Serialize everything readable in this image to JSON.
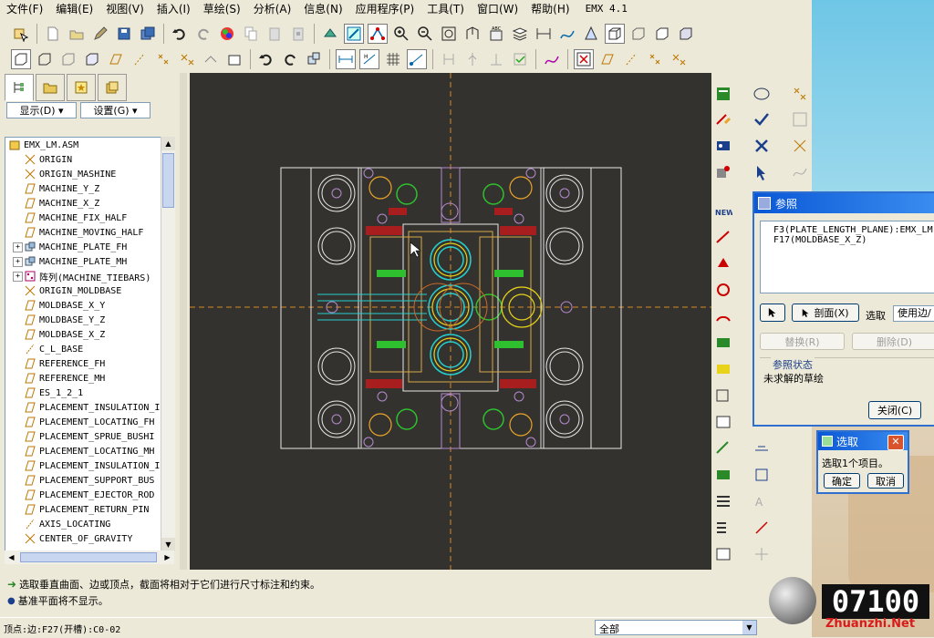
{
  "menu": [
    "文件(F)",
    "编辑(E)",
    "视图(V)",
    "插入(I)",
    "草绘(S)",
    "分析(A)",
    "信息(N)",
    "应用程序(P)",
    "工具(T)",
    "窗口(W)",
    "帮助(H)"
  ],
  "menu_version": "EMX 4.1",
  "left_panel": {
    "show_label": "显示(D) ▾",
    "settings_label": "设置(G) ▾",
    "tree": [
      {
        "label": "EMX_LM.ASM",
        "type": "asm",
        "indent": 0,
        "expander": ""
      },
      {
        "label": "ORIGIN",
        "type": "csys",
        "indent": 1,
        "expander": ""
      },
      {
        "label": "ORIGIN_MASHINE",
        "type": "csys",
        "indent": 1,
        "expander": ""
      },
      {
        "label": "MACHINE_Y_Z",
        "type": "plane",
        "indent": 1,
        "expander": ""
      },
      {
        "label": "MACHINE_X_Z",
        "type": "plane",
        "indent": 1,
        "expander": ""
      },
      {
        "label": "MACHINE_FIX_HALF",
        "type": "plane",
        "indent": 1,
        "expander": ""
      },
      {
        "label": "MACHINE_MOVING_HALF",
        "type": "plane",
        "indent": 1,
        "expander": ""
      },
      {
        "label": "MACHINE_PLATE_FH",
        "type": "part",
        "indent": 1,
        "expander": "+"
      },
      {
        "label": "MACHINE_PLATE_MH",
        "type": "part",
        "indent": 1,
        "expander": "+"
      },
      {
        "label": "阵列(MACHINE_TIEBARS)",
        "type": "pattern",
        "indent": 1,
        "expander": "+"
      },
      {
        "label": "ORIGIN_MOLDBASE",
        "type": "csys",
        "indent": 1,
        "expander": ""
      },
      {
        "label": "MOLDBASE_X_Y",
        "type": "plane",
        "indent": 1,
        "expander": ""
      },
      {
        "label": "MOLDBASE_Y_Z",
        "type": "plane",
        "indent": 1,
        "expander": ""
      },
      {
        "label": "MOLDBASE_X_Z",
        "type": "plane",
        "indent": 1,
        "expander": ""
      },
      {
        "label": "C_L_BASE",
        "type": "axis",
        "indent": 1,
        "expander": ""
      },
      {
        "label": "REFERENCE_FH",
        "type": "plane",
        "indent": 1,
        "expander": ""
      },
      {
        "label": "REFERENCE_MH",
        "type": "plane",
        "indent": 1,
        "expander": ""
      },
      {
        "label": "ES_1_2_1",
        "type": "plane",
        "indent": 1,
        "expander": ""
      },
      {
        "label": "PLACEMENT_INSULATION_I",
        "type": "plane",
        "indent": 1,
        "expander": ""
      },
      {
        "label": "PLACEMENT_LOCATING_FH",
        "type": "plane",
        "indent": 1,
        "expander": ""
      },
      {
        "label": "PLACEMENT_SPRUE_BUSHI",
        "type": "plane",
        "indent": 1,
        "expander": ""
      },
      {
        "label": "PLACEMENT_LOCATING_MH",
        "type": "plane",
        "indent": 1,
        "expander": ""
      },
      {
        "label": "PLACEMENT_INSULATION_I",
        "type": "plane",
        "indent": 1,
        "expander": ""
      },
      {
        "label": "PLACEMENT_SUPPORT_BUS",
        "type": "plane",
        "indent": 1,
        "expander": ""
      },
      {
        "label": "PLACEMENT_EJECTOR_ROD",
        "type": "plane",
        "indent": 1,
        "expander": ""
      },
      {
        "label": "PLACEMENT_RETURN_PIN",
        "type": "plane",
        "indent": 1,
        "expander": ""
      },
      {
        "label": "AXIS_LOCATING",
        "type": "axis",
        "indent": 1,
        "expander": ""
      },
      {
        "label": "CENTER_OF_GRAVITY",
        "type": "csys",
        "indent": 1,
        "expander": ""
      }
    ]
  },
  "ref_dialog": {
    "title": "参照",
    "refs": [
      "F3(PLATE_LENGTH_PLANE):EMX_LM",
      "F17(MOLDBASE_X_Z)"
    ],
    "section_btn": "剖面(X)",
    "select_label": "选取",
    "select_value": "使用边/",
    "replace_btn": "替换(R)",
    "delete_btn": "删除(D)",
    "status_heading": "参照状态",
    "status_text": "未求解的草绘",
    "close_btn": "关闭(C)"
  },
  "select_dialog": {
    "title": "选取",
    "message": "选取1个项目。",
    "ok_btn": "确定",
    "cancel_btn": "取消"
  },
  "messages": [
    "选取垂直曲面、边或顶点，截面将相对于它们进行尺寸标注和约束。",
    "基准平面将不显示。"
  ],
  "status": {
    "left": "顶点:边:F27(开槽):C0-02",
    "filter": "全部"
  },
  "watermark": {
    "number": "07100",
    "site": "Zhuanzhi.Net"
  },
  "colors": {
    "graphics_bg": "#34322e",
    "accent": "#0a58d6",
    "cyan": "#25d0d0",
    "yellow": "#e8d21a",
    "green": "#2ec02e",
    "red": "#c82020"
  }
}
